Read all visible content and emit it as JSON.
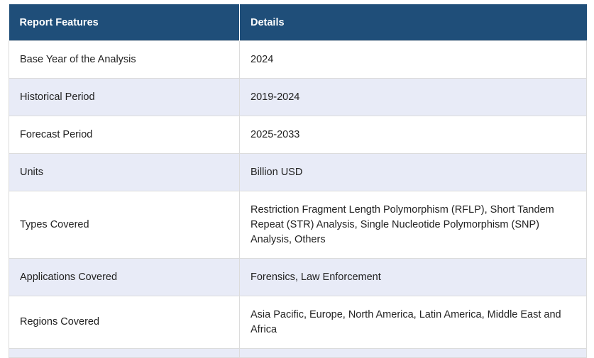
{
  "table": {
    "headers": [
      "Report Features",
      "Details"
    ],
    "rows": [
      {
        "feature": "Base Year of the Analysis",
        "details": "2024"
      },
      {
        "feature": "Historical Period",
        "details": "2019-2024"
      },
      {
        "feature": "Forecast Period",
        "details": "2025-2033"
      },
      {
        "feature": "Units",
        "details": "Billion USD"
      },
      {
        "feature": "Types Covered",
        "details": "Restriction Fragment Length Polymorphism (RFLP), Short Tandem Repeat (STR) Analysis, Single Nucleotide Polymorphism (SNP) Analysis, Others"
      },
      {
        "feature": "Applications Covered",
        "details": "Forensics, Law Enforcement"
      },
      {
        "feature": "Regions Covered",
        "details": "Asia Pacific, Europe, North America, Latin America, Middle East and Africa"
      }
    ]
  },
  "colors": {
    "header_bg": "#1f4e79",
    "header_text": "#ffffff",
    "row_alt_bg": "#e8ebf7",
    "border": "#dcdcdc"
  }
}
